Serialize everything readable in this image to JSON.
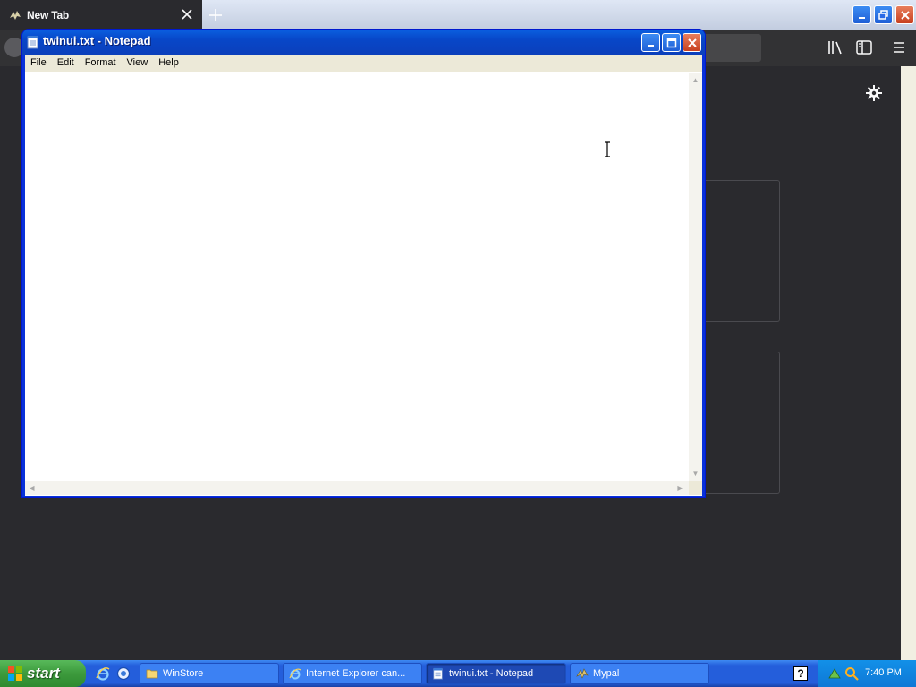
{
  "browser": {
    "tab_title": "New Tab"
  },
  "notepad": {
    "title": "twinui.txt - Notepad",
    "menu": [
      "File",
      "Edit",
      "Format",
      "View",
      "Help"
    ],
    "content": ""
  },
  "taskbar": {
    "start_label": "start",
    "tasks": [
      {
        "label": "WinStore",
        "icon": "folder-icon"
      },
      {
        "label": "Internet Explorer can...",
        "icon": "ie-icon"
      },
      {
        "label": "twinui.txt - Notepad",
        "icon": "notepad-icon",
        "active": true
      },
      {
        "label": "Mypal",
        "icon": "mypal-icon"
      }
    ],
    "help_label": "?",
    "clock": "7:40 PM"
  },
  "colors": {
    "xp_blue": "#245edb",
    "start_green": "#3c9a3c",
    "browser_dark": "#2a2a2e"
  }
}
